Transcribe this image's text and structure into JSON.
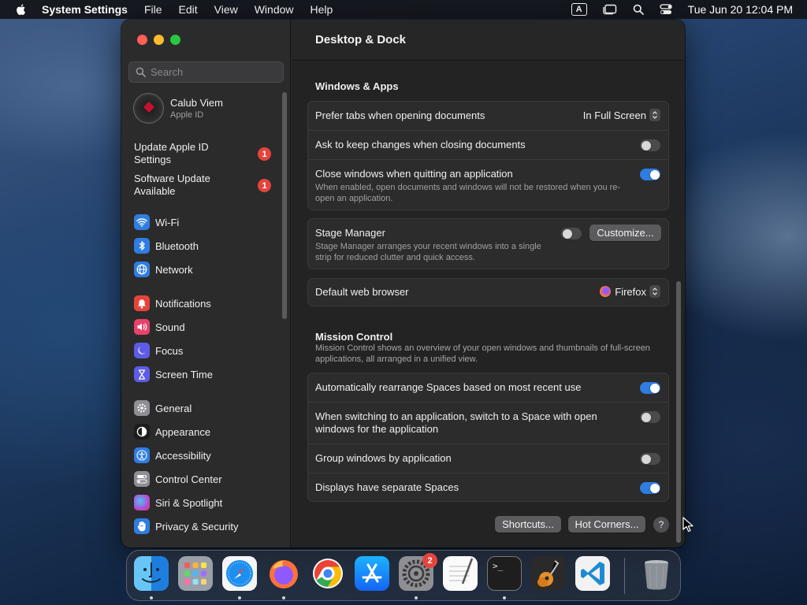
{
  "menubar": {
    "app_name": "System Settings",
    "menus": [
      "File",
      "Edit",
      "View",
      "Window",
      "Help"
    ],
    "input_source": "A",
    "clock": "Tue Jun 20  12:04 PM"
  },
  "sidebar": {
    "search_placeholder": "Search",
    "profile": {
      "name": "Calub Viem",
      "subtitle": "Apple ID"
    },
    "alerts": [
      {
        "label": "Update Apple ID Settings",
        "count": "1"
      },
      {
        "label": "Software Update Available",
        "count": "1"
      }
    ],
    "items": [
      {
        "label": "Wi-Fi",
        "icon": "wifi-icon",
        "color": "#2f7de1"
      },
      {
        "label": "Bluetooth",
        "icon": "bluetooth-icon",
        "color": "#2f7de1"
      },
      {
        "label": "Network",
        "icon": "globe-icon",
        "color": "#2f7de1"
      },
      {
        "label": "Notifications",
        "icon": "bell-icon",
        "color": "#e5443c"
      },
      {
        "label": "Sound",
        "icon": "speaker-icon",
        "color": "#e8416b"
      },
      {
        "label": "Focus",
        "icon": "moon-icon",
        "color": "#5e5ce6"
      },
      {
        "label": "Screen Time",
        "icon": "hourglass-icon",
        "color": "#5e5ce6"
      },
      {
        "label": "General",
        "icon": "gear-icon",
        "color": "#8e8e93"
      },
      {
        "label": "Appearance",
        "icon": "appearance-icon",
        "color": "#1c1c1e"
      },
      {
        "label": "Accessibility",
        "icon": "accessibility-icon",
        "color": "#2f7de1"
      },
      {
        "label": "Control Center",
        "icon": "switches-icon",
        "color": "#8e8e93"
      },
      {
        "label": "Siri & Spotlight",
        "icon": "siri-icon",
        "color": "#b44ad9"
      },
      {
        "label": "Privacy & Security",
        "icon": "hand-icon",
        "color": "#2f7de1"
      }
    ]
  },
  "content": {
    "title": "Desktop & Dock",
    "windows_apps": {
      "title": "Windows & Apps",
      "prefer_tabs": {
        "label": "Prefer tabs when opening documents",
        "value": "In Full Screen"
      },
      "ask_keep": {
        "label": "Ask to keep changes when closing documents",
        "on": false
      },
      "close_windows": {
        "label": "Close windows when quitting an application",
        "desc": "When enabled, open documents and windows will not be restored when you re-open an application.",
        "on": true
      }
    },
    "stage_manager": {
      "label": "Stage Manager",
      "desc": "Stage Manager arranges your recent windows into a single strip for reduced clutter and quick access.",
      "on": false,
      "button": "Customize..."
    },
    "browser": {
      "label": "Default web browser",
      "value": "Firefox"
    },
    "mission_control": {
      "title": "Mission Control",
      "desc": "Mission Control shows an overview of your open windows and thumbnails of full-screen applications, all arranged in a unified view.",
      "rows": [
        {
          "label": "Automatically rearrange Spaces based on most recent use",
          "on": true
        },
        {
          "label": "When switching to an application, switch to a Space with open windows for the application",
          "on": false
        },
        {
          "label": "Group windows by application",
          "on": false
        },
        {
          "label": "Displays have separate Spaces",
          "on": true
        }
      ]
    },
    "buttons": {
      "shortcuts": "Shortcuts...",
      "hot_corners": "Hot Corners...",
      "help": "?"
    }
  },
  "dock": {
    "apps": [
      {
        "name": "Finder",
        "icon": "finder-icon",
        "running": true
      },
      {
        "name": "Launchpad",
        "icon": "launchpad-icon",
        "running": false
      },
      {
        "name": "Safari",
        "icon": "safari-icon",
        "running": true
      },
      {
        "name": "Firefox",
        "icon": "firefox-icon",
        "running": true
      },
      {
        "name": "Chrome",
        "icon": "chrome-icon",
        "running": false
      },
      {
        "name": "App Store",
        "icon": "app-store-icon",
        "running": false
      },
      {
        "name": "System Settings",
        "icon": "system-settings-icon",
        "running": true,
        "badge": "2"
      },
      {
        "name": "TextEdit",
        "icon": "textedit-icon",
        "running": false
      },
      {
        "name": "Terminal",
        "icon": "terminal-icon",
        "running": true
      },
      {
        "name": "GarageBand",
        "icon": "garageband-icon",
        "running": false
      },
      {
        "name": "Visual Studio Code",
        "icon": "vscode-icon",
        "running": false
      },
      {
        "name": "Trash",
        "icon": "trash-icon",
        "running": false
      }
    ],
    "terminal_prompt": ">_"
  }
}
